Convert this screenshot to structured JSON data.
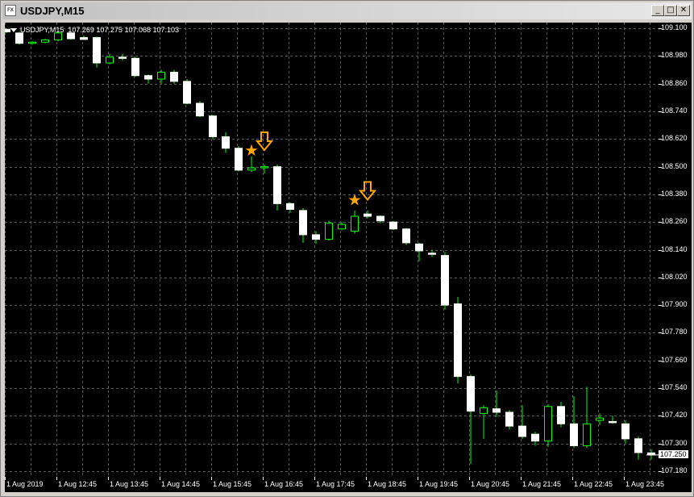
{
  "window": {
    "title": "USDJPY,M15",
    "icon_label": "FX"
  },
  "controls": {
    "minimize": "_",
    "maximize": "□",
    "close": "✕"
  },
  "chart": {
    "symbol_line": "USDJPY,M15",
    "ohlc_line": "107.269 107.275 107.068 107.103",
    "background_color": "#000000",
    "grid_color": "#5a5a5a",
    "bull_body_color": "#000000",
    "bull_border_color": "#00ff00",
    "bear_body_color": "#ffffff",
    "wick_color": "#00ff00",
    "marker_color": "#ffa500"
  },
  "price_axis": {
    "labels": [
      "109.100",
      "108.980",
      "108.860",
      "108.740",
      "108.620",
      "108.500",
      "108.380",
      "108.260",
      "108.140",
      "108.020",
      "107.900",
      "107.780",
      "107.660",
      "107.540",
      "107.420",
      "107.300",
      "107.180"
    ],
    "current_price": "107.250"
  },
  "time_axis": {
    "labels": [
      "1 Aug 2019",
      "1 Aug 12:45",
      "1 Aug 13:45",
      "1 Aug 14:45",
      "1 Aug 15:45",
      "1 Aug 16:45",
      "1 Aug 17:45",
      "1 Aug 18:45",
      "1 Aug 19:45",
      "1 Aug 20:45",
      "1 Aug 21:45",
      "1 Aug 22:45",
      "1 Aug 23:45"
    ]
  },
  "chart_data": {
    "type": "candlestick",
    "symbol": "USDJPY",
    "timeframe": "M15",
    "ylim": [
      107.155,
      109.125
    ],
    "candles": [
      {
        "o": 109.096,
        "h": 109.1,
        "l": 109.08,
        "c": 109.085
      },
      {
        "o": 109.08,
        "h": 109.085,
        "l": 109.03,
        "c": 109.035
      },
      {
        "o": 109.035,
        "h": 109.045,
        "l": 109.03,
        "c": 109.04
      },
      {
        "o": 109.04,
        "h": 109.055,
        "l": 109.035,
        "c": 109.05
      },
      {
        "o": 109.05,
        "h": 109.085,
        "l": 109.045,
        "c": 109.08
      },
      {
        "o": 109.08,
        "h": 109.085,
        "l": 109.05,
        "c": 109.055
      },
      {
        "o": 109.06,
        "h": 109.068,
        "l": 109.05,
        "c": 109.052
      },
      {
        "o": 109.06,
        "h": 109.065,
        "l": 108.93,
        "c": 108.95
      },
      {
        "o": 108.95,
        "h": 108.99,
        "l": 108.945,
        "c": 108.975
      },
      {
        "o": 108.975,
        "h": 108.99,
        "l": 108.96,
        "c": 108.97
      },
      {
        "o": 108.97,
        "h": 108.975,
        "l": 108.89,
        "c": 108.895
      },
      {
        "o": 108.895,
        "h": 108.9,
        "l": 108.86,
        "c": 108.88
      },
      {
        "o": 108.88,
        "h": 108.92,
        "l": 108.86,
        "c": 108.91
      },
      {
        "o": 108.91,
        "h": 108.92,
        "l": 108.86,
        "c": 108.87
      },
      {
        "o": 108.87,
        "h": 108.88,
        "l": 108.77,
        "c": 108.775
      },
      {
        "o": 108.775,
        "h": 108.785,
        "l": 108.715,
        "c": 108.72
      },
      {
        "o": 108.72,
        "h": 108.725,
        "l": 108.62,
        "c": 108.63
      },
      {
        "o": 108.63,
        "h": 108.65,
        "l": 108.56,
        "c": 108.58
      },
      {
        "o": 108.58,
        "h": 108.59,
        "l": 108.48,
        "c": 108.485
      },
      {
        "o": 108.485,
        "h": 108.545,
        "l": 108.478,
        "c": 108.495
      },
      {
        "o": 108.495,
        "h": 108.51,
        "l": 108.47,
        "c": 108.5
      },
      {
        "o": 108.5,
        "h": 108.51,
        "l": 108.31,
        "c": 108.34
      },
      {
        "o": 108.34,
        "h": 108.345,
        "l": 108.3,
        "c": 108.315
      },
      {
        "o": 108.31,
        "h": 108.32,
        "l": 108.17,
        "c": 108.205
      },
      {
        "o": 108.205,
        "h": 108.22,
        "l": 108.165,
        "c": 108.185
      },
      {
        "o": 108.185,
        "h": 108.265,
        "l": 108.18,
        "c": 108.255
      },
      {
        "o": 108.23,
        "h": 108.26,
        "l": 108.225,
        "c": 108.25
      },
      {
        "o": 108.22,
        "h": 108.31,
        "l": 108.21,
        "c": 108.285
      },
      {
        "o": 108.295,
        "h": 108.31,
        "l": 108.275,
        "c": 108.285
      },
      {
        "o": 108.285,
        "h": 108.29,
        "l": 108.255,
        "c": 108.265
      },
      {
        "o": 108.26,
        "h": 108.265,
        "l": 108.225,
        "c": 108.23
      },
      {
        "o": 108.23,
        "h": 108.235,
        "l": 108.16,
        "c": 108.17
      },
      {
        "o": 108.165,
        "h": 108.17,
        "l": 108.09,
        "c": 108.135
      },
      {
        "o": 108.125,
        "h": 108.14,
        "l": 108.11,
        "c": 108.12
      },
      {
        "o": 108.115,
        "h": 108.13,
        "l": 107.88,
        "c": 107.9
      },
      {
        "o": 107.905,
        "h": 107.935,
        "l": 107.56,
        "c": 107.59
      },
      {
        "o": 107.59,
        "h": 107.6,
        "l": 107.21,
        "c": 107.44
      },
      {
        "o": 107.43,
        "h": 107.465,
        "l": 107.32,
        "c": 107.455
      },
      {
        "o": 107.45,
        "h": 107.53,
        "l": 107.415,
        "c": 107.435
      },
      {
        "o": 107.435,
        "h": 107.445,
        "l": 107.36,
        "c": 107.375
      },
      {
        "o": 107.375,
        "h": 107.465,
        "l": 107.32,
        "c": 107.33
      },
      {
        "o": 107.34,
        "h": 107.35,
        "l": 107.29,
        "c": 107.31
      },
      {
        "o": 107.31,
        "h": 107.47,
        "l": 107.285,
        "c": 107.46
      },
      {
        "o": 107.46,
        "h": 107.48,
        "l": 107.37,
        "c": 107.385
      },
      {
        "o": 107.385,
        "h": 107.505,
        "l": 107.28,
        "c": 107.29
      },
      {
        "o": 107.29,
        "h": 107.545,
        "l": 107.28,
        "c": 107.385
      },
      {
        "o": 107.4,
        "h": 107.43,
        "l": 107.38,
        "c": 107.41
      },
      {
        "o": 107.395,
        "h": 107.42,
        "l": 107.385,
        "c": 107.39
      },
      {
        "o": 107.385,
        "h": 107.4,
        "l": 107.3,
        "c": 107.32
      },
      {
        "o": 107.32,
        "h": 107.33,
        "l": 107.23,
        "c": 107.26
      },
      {
        "o": 107.259,
        "h": 107.275,
        "l": 107.23,
        "c": 107.25
      }
    ],
    "markers": [
      {
        "type": "star",
        "index": 19,
        "price": 108.57
      },
      {
        "type": "arrow-down",
        "index": 20,
        "price": 108.6
      },
      {
        "type": "star",
        "index": 27,
        "price": 108.355
      },
      {
        "type": "arrow-down",
        "index": 28,
        "price": 108.385
      }
    ]
  }
}
